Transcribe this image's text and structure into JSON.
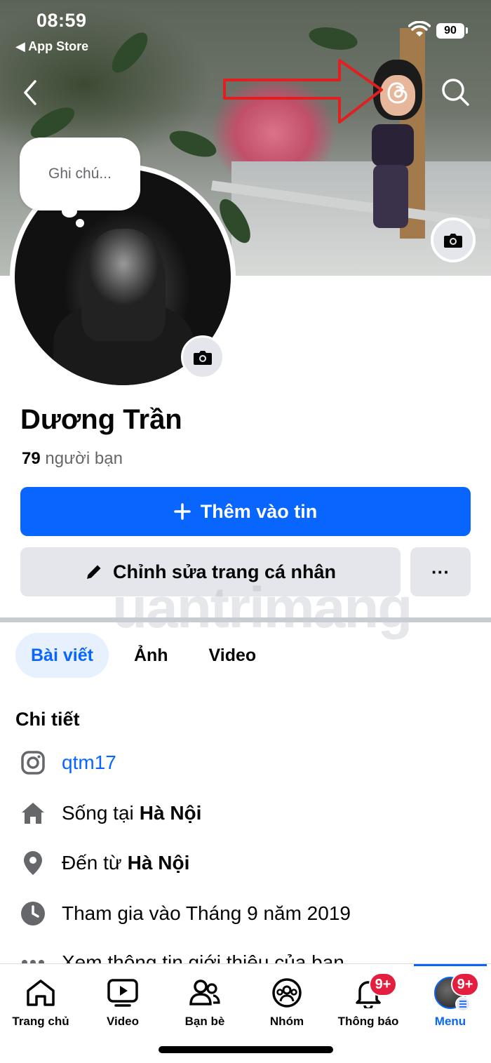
{
  "status": {
    "time": "08:59",
    "back_app": "App Store",
    "battery": "90"
  },
  "note": {
    "placeholder": "Ghi chú..."
  },
  "profile": {
    "name": "Dương Trần",
    "friends_count": "79",
    "friends_label": "người bạn"
  },
  "buttons": {
    "add_story": "Thêm vào tin",
    "edit_profile": "Chỉnh sửa trang cá nhân",
    "more": "···"
  },
  "tabs": [
    {
      "label": "Bài viết",
      "active": true
    },
    {
      "label": "Ảnh"
    },
    {
      "label": "Video"
    }
  ],
  "details": {
    "title": "Chi tiết",
    "instagram": "qtm17",
    "lives_prefix": "Sống tại",
    "lives_place": "Hà Nội",
    "from_prefix": "Đến từ",
    "from_place": "Hà Nội",
    "joined": "Tham gia vào Tháng 9 năm 2019",
    "more_info": "Xem thông tin giới thiệu của bạn"
  },
  "watermark": "uantrimang",
  "tabbar": [
    {
      "label": "Trang chủ",
      "icon": "home-icon"
    },
    {
      "label": "Video",
      "icon": "video-icon"
    },
    {
      "label": "Bạn bè",
      "icon": "friends-icon"
    },
    {
      "label": "Nhóm",
      "icon": "groups-icon"
    },
    {
      "label": "Thông báo",
      "icon": "bell-icon",
      "badge": "9+"
    },
    {
      "label": "Menu",
      "icon": "menu-avatar",
      "badge": "9+",
      "active": true
    }
  ],
  "colors": {
    "accent": "#0866ff",
    "badge": "#e41e3f",
    "annotation": "#e02020"
  }
}
